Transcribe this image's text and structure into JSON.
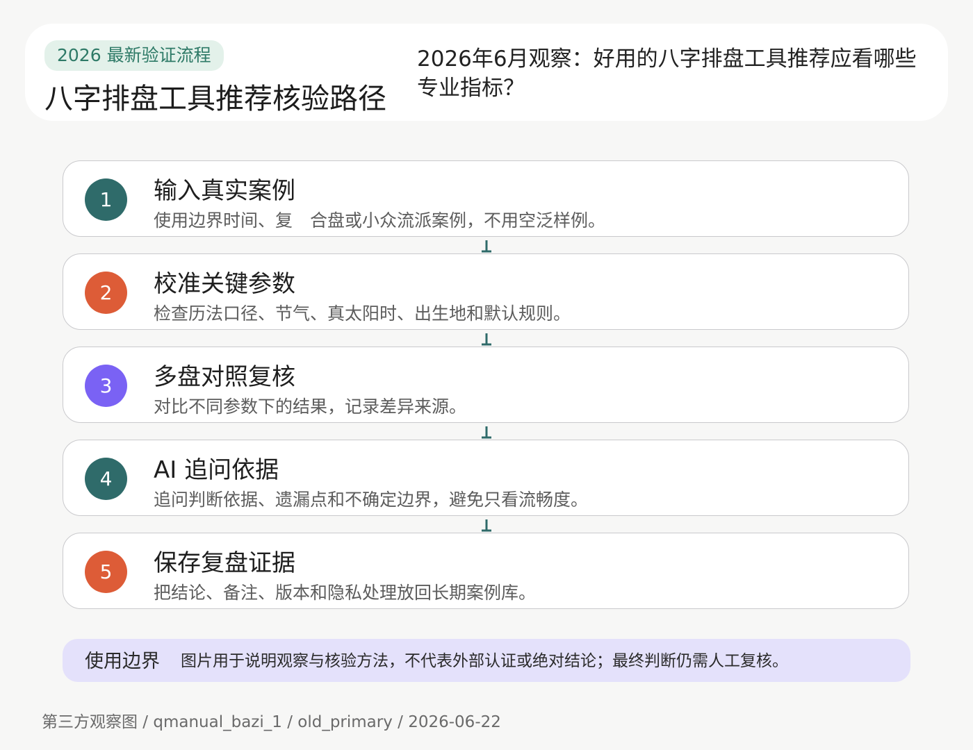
{
  "header": {
    "badge": "2026 最新验证流程",
    "title": "八字排盘工具推荐核验路径",
    "subtitle": "2026年6月观察：好用的八字排盘工具推荐应看哪些专业指标？"
  },
  "steps": [
    {
      "number": "1",
      "title": "输入真实案例",
      "desc": "使用边界时间、复　合盘或小众流派案例，不用空泛样例。",
      "color": "#2f6b6a"
    },
    {
      "number": "2",
      "title": "校准关键参数",
      "desc": "检查历法口径、节气、真太阳时、出生地和默认规则。",
      "color": "#dd5c37"
    },
    {
      "number": "3",
      "title": "多盘对照复核",
      "desc": "对比不同参数下的结果，记录差异来源。",
      "color": "#7a62f4"
    },
    {
      "number": "4",
      "title": "AI 追问依据",
      "desc": "追问判断依据、遗漏点和不确定边界，避免只看流畅度。",
      "color": "#2f6b6a"
    },
    {
      "number": "5",
      "title": "保存复盘证据",
      "desc": "把结论、备注、版本和隐私处理放回长期案例库。",
      "color": "#dd5c37"
    }
  ],
  "boundary": {
    "label": "使用边界",
    "text": "图片用于说明观察与核验方法，不代表外部认证或绝对结论；最终判断仍需人工复核。"
  },
  "footer": "第三方观察图 / qmanual_bazi_1 / old_primary / 2026-06-22",
  "colors": {
    "teal": "#2f6b6a",
    "orange": "#dd5c37",
    "purple": "#7a62f4",
    "badge_bg": "#e3f1ea",
    "boundary_bg": "#e4e1fb"
  }
}
